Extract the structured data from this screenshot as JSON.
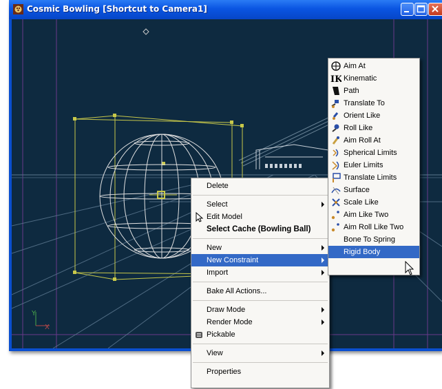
{
  "window": {
    "title": "Cosmic Bowling [Shortcut to Camera1]",
    "app_icon": "bowling-app-icon",
    "controls": [
      "minimize-icon",
      "maximize-icon",
      "close-icon"
    ]
  },
  "viewport": {
    "axis_labels": {
      "y": "Y",
      "x": "X"
    }
  },
  "context_menu": {
    "items": [
      {
        "label": "Delete"
      },
      {
        "label": "Select",
        "submenu": true
      },
      {
        "label": "Edit Model",
        "icon": "edit-model-cursor-icon"
      },
      {
        "label": "Select Cache (Bowling Ball)",
        "bold": true
      },
      {
        "label": "New",
        "submenu": true
      },
      {
        "label": "New Constraint",
        "submenu": true,
        "highlighted": true
      },
      {
        "label": "Import",
        "submenu": true
      },
      {
        "label": "Bake All Actions..."
      },
      {
        "label": "Draw Mode",
        "submenu": true
      },
      {
        "label": "Render Mode",
        "submenu": true
      },
      {
        "label": "Pickable",
        "icon": "pickable-icon"
      },
      {
        "label": "View",
        "submenu": true
      },
      {
        "label": "Properties"
      }
    ]
  },
  "constraint_submenu": {
    "items": [
      {
        "label": "Aim At",
        "icon": "aim-at-crosshair-icon"
      },
      {
        "label": "Kinematic",
        "icon": "ik-kinematic-icon",
        "icon_text": "IK"
      },
      {
        "label": "Path",
        "icon": "path-icon"
      },
      {
        "label": "Translate To",
        "icon": "translate-to-icon"
      },
      {
        "label": "Orient Like",
        "icon": "orient-like-icon"
      },
      {
        "label": "Roll Like",
        "icon": "roll-like-icon"
      },
      {
        "label": "Aim Roll At",
        "icon": "aim-roll-at-icon"
      },
      {
        "label": "Spherical Limits",
        "icon": "spherical-limits-icon"
      },
      {
        "label": "Euler Limits",
        "icon": "euler-limits-icon"
      },
      {
        "label": "Translate Limits",
        "icon": "translate-limits-icon"
      },
      {
        "label": "Surface",
        "icon": "surface-icon"
      },
      {
        "label": "Scale Like",
        "icon": "scale-like-icon"
      },
      {
        "label": "Aim Like Two",
        "icon": "aim-like-two-icon"
      },
      {
        "label": "Aim Roll Like Two",
        "icon": "aim-roll-like-two-icon"
      },
      {
        "label": "Bone To Spring"
      },
      {
        "label": "Rigid Body",
        "highlighted": true
      }
    ]
  },
  "colors": {
    "titlebar": "#0a55e2",
    "viewport_bg": "#0e2a40",
    "menu_highlight": "#3369c6",
    "wireframe": "#d8d8d8",
    "selection": "#c8c84a"
  }
}
